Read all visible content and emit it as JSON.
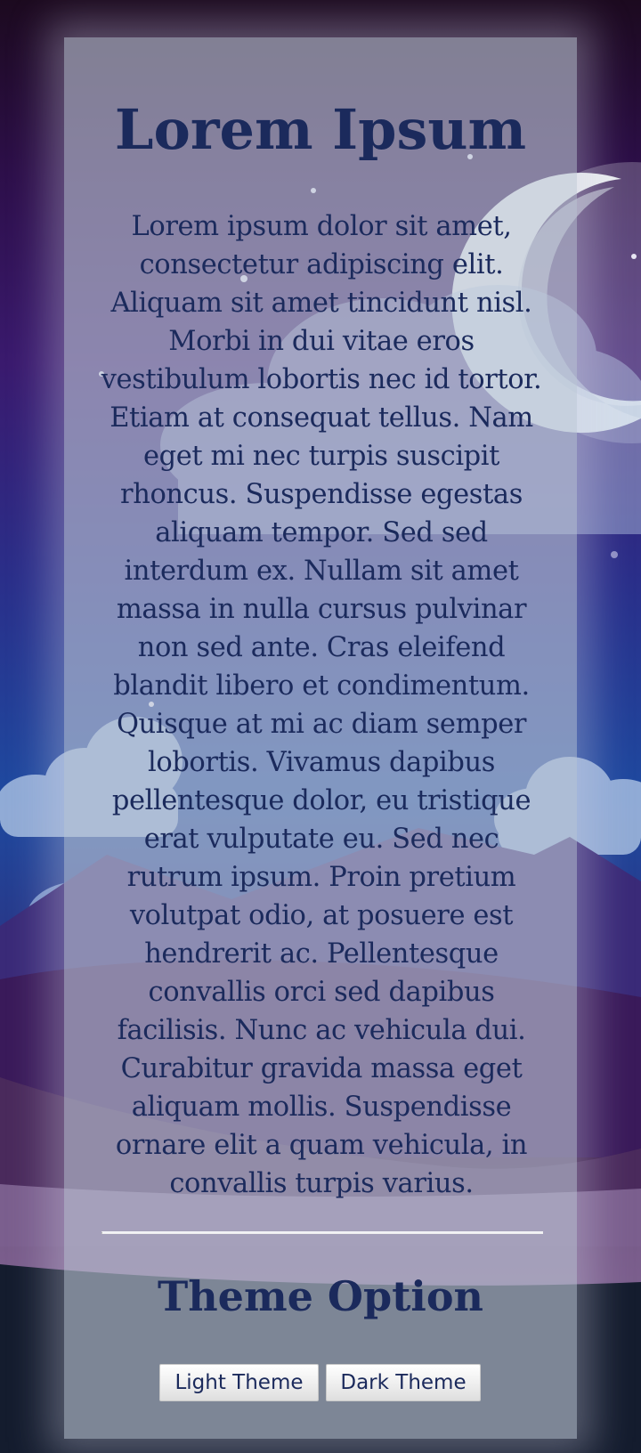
{
  "page": {
    "title": "Lorem Ipsum",
    "body": "Lorem ipsum dolor sit amet, consectetur adipiscing elit. Aliquam sit amet tincidunt nisl. Morbi in dui vitae eros vestibulum lobortis nec id tortor. Etiam at consequat tellus. Nam eget mi nec turpis suscipit rhoncus. Suspendisse egestas aliquam tempor. Sed sed interdum ex. Nullam sit amet massa in nulla cursus pulvinar non sed ante. Cras eleifend blandit libero et condimentum. Quisque at mi ac diam semper lobortis. Vivamus dapibus pellentesque dolor, eu tristique erat vulputate eu. Sed nec rutrum ipsum. Proin pretium volutpat odio, at posuere est hendrerit ac. Pellentesque convallis orci sed dapibus facilisis. Nunc ac vehicula dui. Curabitur gravida massa eget aliquam mollis. Suspendisse ornare elit a quam vehicula, in convallis turpis varius."
  },
  "theme_section": {
    "title": "Theme Option",
    "light_button": "Light Theme",
    "dark_button": "Dark Theme"
  },
  "colors": {
    "text": "#1b2a5c",
    "panel": "#bec8d7",
    "divider": "#f2f2f6"
  },
  "background": {
    "moon_icon": "crescent-moon-icon",
    "scene": "night-sky-with-clouds-and-mountains"
  }
}
